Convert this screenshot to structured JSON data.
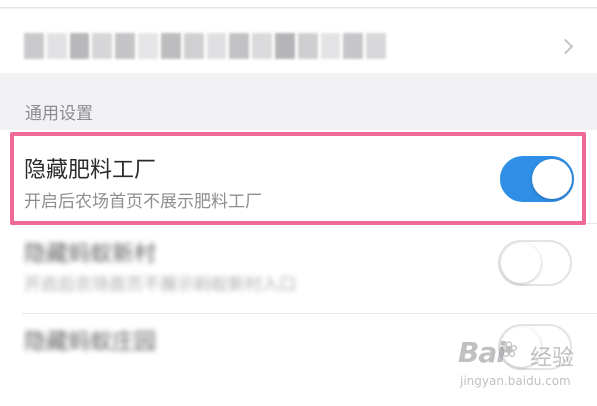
{
  "top_row": {
    "text": "",
    "chevron_icon": "chevron-right-icon"
  },
  "section": {
    "title": "通用设置"
  },
  "settings": [
    {
      "title": "隐藏肥料工厂",
      "description": "开启后农场首页不展示肥料工厂",
      "enabled": true
    },
    {
      "title": "隐藏蚂蚁新村",
      "description": "开启后农场首页不展示蚂蚁新村入口",
      "enabled": false
    },
    {
      "title": "隐藏蚂蚁庄园",
      "description": "",
      "enabled": false
    }
  ],
  "watermark": {
    "logo": "Bai",
    "paw_icon": "paw-icon",
    "brand": "经验",
    "url": "jingyan.baidu.com"
  },
  "colors": {
    "toggle_on": "#2f8fe6",
    "highlight": "#f06a98",
    "background": "#f2f2f4"
  }
}
